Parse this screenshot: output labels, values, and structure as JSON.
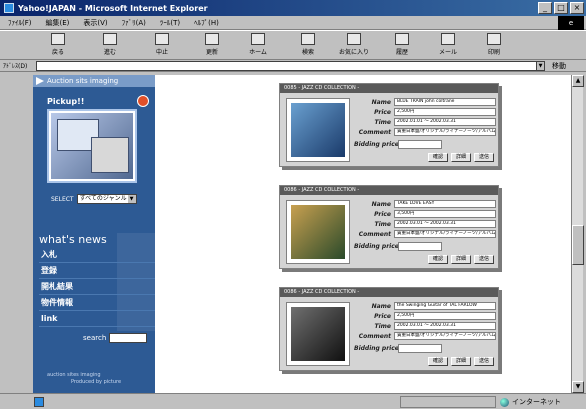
{
  "window": {
    "title": "Yahoo!JAPAN - Microsoft Internet Explorer",
    "controls": [
      "_",
      "□",
      "×"
    ]
  },
  "menu": [
    "ﾌｧｲﾙ(F)",
    "編集(E)",
    "表示(V)",
    "ﾌｧﾞﾘ(A)",
    "ﾂｰﾙ(T)",
    "ﾍﾙﾌﾟ(H)"
  ],
  "toolbar": {
    "buttons": [
      {
        "label": "戻る",
        "icon": "back-arrow-icon"
      },
      {
        "label": "進む",
        "icon": "forward-arrow-icon"
      },
      {
        "label": "中止",
        "icon": "stop-icon"
      },
      {
        "label": "更新",
        "icon": "refresh-icon"
      },
      {
        "label": "ホーム",
        "icon": "home-icon"
      },
      {
        "label": "検索",
        "icon": "search-icon"
      },
      {
        "label": "お気に入り",
        "icon": "favorites-icon"
      },
      {
        "label": "履歴",
        "icon": "history-icon"
      },
      {
        "label": "メール",
        "icon": "mail-icon"
      },
      {
        "label": "印刷",
        "icon": "print-icon"
      }
    ]
  },
  "address": {
    "label": "ｱﾄﾞﾚｽ(D)",
    "value": "",
    "go_label": "移動"
  },
  "nav": {
    "header": "Auction sits imaging",
    "pickup": "Pickup!!",
    "select_label": "SELECT",
    "select_value": "すべてのジャンル",
    "whats_new": "what's news",
    "items": [
      "入札",
      "登録",
      "開札結果",
      "物件情報",
      "link"
    ],
    "search_label": "search",
    "footer1": "auction sites imaging",
    "footer2": "Produced by picture"
  },
  "items": [
    {
      "bar": "0085 - JAZZ CD COLLECTION -",
      "labels": {
        "name": "Name",
        "price": "Price",
        "time": "Time",
        "comment": "Comment",
        "bidding": "Bidding price"
      },
      "name": "BLUE TRAIN john coltrane",
      "price": "2,500円",
      "time": "2002.01.01 ～ 2002.03.31",
      "comment": "貴重日本盤/オリジナル/ライナーノーツ/アルバム",
      "buttons": [
        "確認",
        "詳細",
        "送信"
      ],
      "cover_color": "#2a5a8a"
    },
    {
      "bar": "0086 - JAZZ CD COLLECTION -",
      "labels": {
        "name": "Name",
        "price": "Price",
        "time": "Time",
        "comment": "Comment",
        "bidding": "Bidding price"
      },
      "name": "TAKE  LOVE EASY",
      "price": "3,500円",
      "time": "2002.03.01 ～ 2002.03.31",
      "comment": "貴重日本盤/オリジナル/ライナーノーツ/アルバム",
      "buttons": [
        "確認",
        "詳細",
        "送信"
      ],
      "cover_color": "#3a6a3a"
    },
    {
      "bar": "0086 - JAZZ CD COLLECTION -",
      "labels": {
        "name": "Name",
        "price": "Price",
        "time": "Time",
        "comment": "Comment",
        "bidding": "Bidding price"
      },
      "name": "the Swinging Guitar of TAL FARLOW",
      "price": "2,500円",
      "time": "2002.03.01 ～ 2002.03.31",
      "comment": "貴重日本盤/オリジナル/ライナーノーツ/アルバム",
      "buttons": [
        "確認",
        "詳細",
        "送信"
      ],
      "cover_color": "#303030"
    }
  ],
  "status": {
    "zone": "インターネット"
  }
}
